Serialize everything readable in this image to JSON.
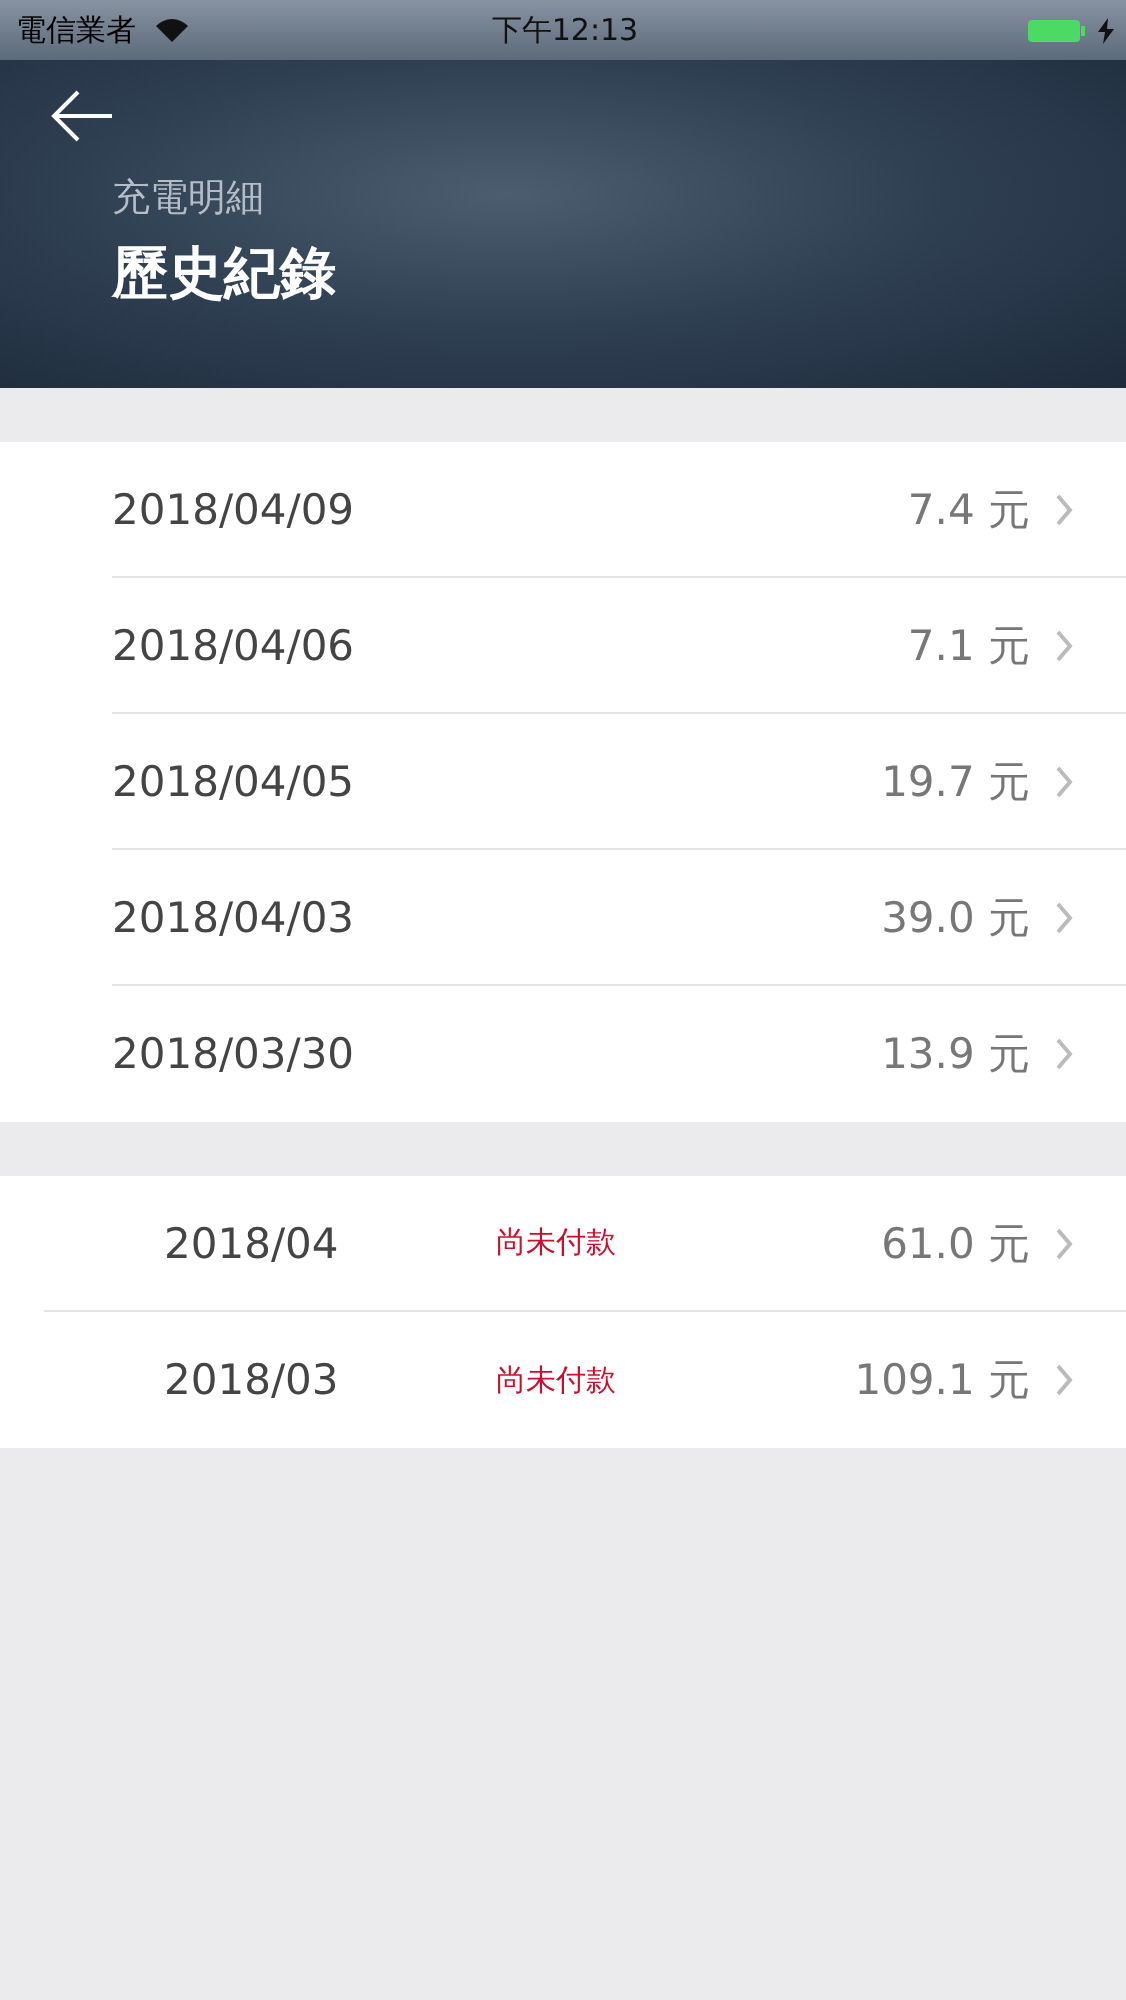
{
  "status_bar": {
    "carrier": "電信業者",
    "time": "下午12:13"
  },
  "header": {
    "subtitle": "充電明細",
    "title": "歷史紀錄"
  },
  "sessions": [
    {
      "date": "2018/04/09",
      "amount": "7.4 元"
    },
    {
      "date": "2018/04/06",
      "amount": "7.1 元"
    },
    {
      "date": "2018/04/05",
      "amount": "19.7 元"
    },
    {
      "date": "2018/04/03",
      "amount": "39.0 元"
    },
    {
      "date": "2018/03/30",
      "amount": "13.9 元"
    }
  ],
  "bills": [
    {
      "month": "2018/04",
      "status": "尚未付款",
      "amount": "61.0 元"
    },
    {
      "month": "2018/03",
      "status": "尚未付款",
      "amount": "109.1 元"
    }
  ]
}
